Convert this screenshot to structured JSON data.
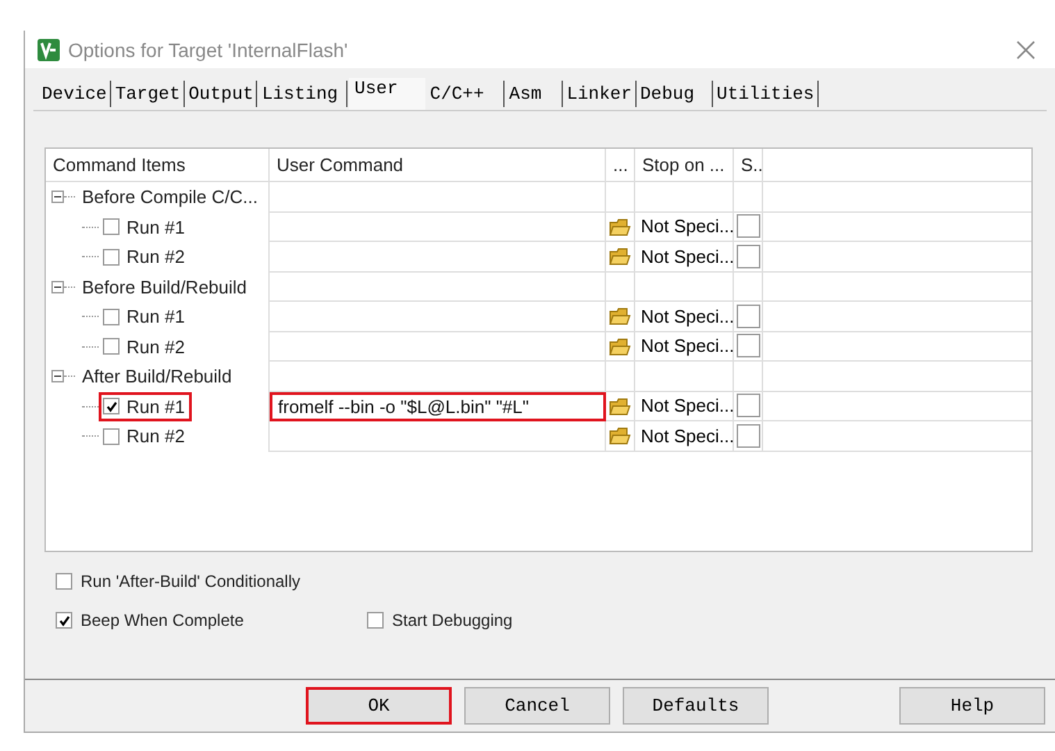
{
  "window": {
    "title": "Options for Target 'InternalFlash'"
  },
  "tabs": [
    {
      "label": "Device",
      "selected": false
    },
    {
      "label": "Target",
      "selected": false
    },
    {
      "label": "Output",
      "selected": false
    },
    {
      "label": "Listing",
      "selected": false
    },
    {
      "label": "User",
      "selected": true
    },
    {
      "label": "C/C++",
      "selected": false
    },
    {
      "label": "Asm",
      "selected": false
    },
    {
      "label": "Linker",
      "selected": false
    },
    {
      "label": "Debug",
      "selected": false
    },
    {
      "label": "Utilities",
      "selected": false
    }
  ],
  "table": {
    "columns": [
      "Command Items",
      "User Command",
      "...",
      "Stop on ...",
      "S.."
    ],
    "groups": [
      {
        "label": "Before Compile C/C...",
        "expanded": true,
        "children": [
          {
            "label": "Run #1",
            "checked": false,
            "stop_on": "Not Speci...",
            "stop_checked": false,
            "highlighted": false
          },
          {
            "label": "Run #2",
            "checked": false,
            "stop_on": "Not Speci...",
            "stop_checked": false,
            "highlighted": false
          }
        ]
      },
      {
        "label": "Before Build/Rebuild",
        "expanded": true,
        "children": [
          {
            "label": "Run #1",
            "checked": false,
            "stop_on": "Not Speci...",
            "stop_checked": false,
            "highlighted": false
          },
          {
            "label": "Run #2",
            "checked": false,
            "stop_on": "Not Speci...",
            "stop_checked": false,
            "highlighted": false
          }
        ]
      },
      {
        "label": "After Build/Rebuild",
        "expanded": true,
        "children": [
          {
            "label": "Run #1",
            "checked": true,
            "command": "fromelf --bin -o \"$L@L.bin\" \"#L\"",
            "stop_on": "Not Speci...",
            "stop_checked": false,
            "highlighted": true
          },
          {
            "label": "Run #2",
            "checked": false,
            "stop_on": "Not Speci...",
            "stop_checked": false,
            "highlighted": false
          }
        ]
      }
    ]
  },
  "options": [
    {
      "label": "Run 'After-Build' Conditionally",
      "checked": false
    },
    {
      "label": "Beep When Complete",
      "checked": true
    },
    {
      "label": "Start Debugging",
      "checked": false
    }
  ],
  "buttons": [
    {
      "label": "OK",
      "highlighted": true
    },
    {
      "label": "Cancel",
      "highlighted": false
    },
    {
      "label": "Defaults",
      "highlighted": false
    },
    {
      "label": "Help",
      "highlighted": false
    }
  ]
}
